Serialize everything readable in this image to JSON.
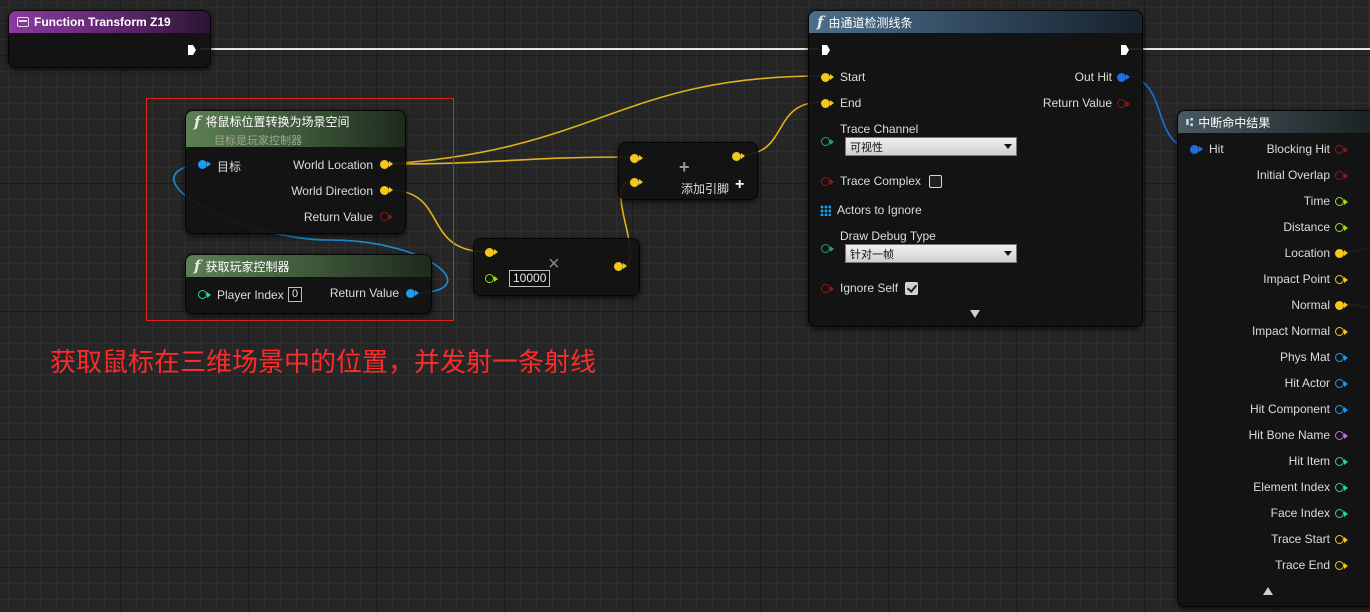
{
  "annotation": "获取鼠标在三维场景中的位置，并发射一条射线",
  "colors": {
    "exec": "#ffffff",
    "vector": "#f2c81b",
    "object": "#1d9bf0",
    "bool": "#8b1818",
    "float": "#96e01a",
    "struct": "#1d6fe0",
    "name": "#b970e0",
    "int": "#20d8a8",
    "selection": "#e02020"
  },
  "nodes": {
    "function_entry": {
      "title": "Function Transform Z19"
    },
    "convert_mouse": {
      "title": "将鼠标位置转换为场景空间",
      "subtitle": "目标是玩家控制器",
      "pin_target": "目标",
      "pin_world_location": "World Location",
      "pin_world_direction": "World Direction",
      "pin_return_value": "Return Value"
    },
    "get_player_controller": {
      "title": "获取玩家控制器",
      "pin_player_index": "Player Index",
      "player_index_value": "0",
      "pin_return_value": "Return Value"
    },
    "multiply": {
      "symbol": "×",
      "value": "10000"
    },
    "add": {
      "symbol": "+",
      "add_pin_label": "添加引脚",
      "add_pin_icon": "+"
    },
    "line_trace": {
      "title": "由通道检测线条",
      "pin_start": "Start",
      "pin_end": "End",
      "pin_out_hit": "Out Hit",
      "pin_return_value": "Return Value",
      "pin_trace_channel": "Trace Channel",
      "trace_channel_value": "可视性",
      "pin_trace_complex": "Trace Complex",
      "trace_complex_checked": false,
      "pin_actors_to_ignore": "Actors to Ignore",
      "pin_draw_debug_type": "Draw Debug Type",
      "draw_debug_type_value": "针对一帧",
      "pin_ignore_self": "Ignore Self",
      "ignore_self_checked": true
    },
    "break_hit": {
      "title": "中断命中结果",
      "pin_hit": "Hit",
      "outputs": [
        {
          "label": "Blocking Hit",
          "type": "bool"
        },
        {
          "label": "Initial Overlap",
          "type": "bool"
        },
        {
          "label": "Time",
          "type": "float"
        },
        {
          "label": "Distance",
          "type": "float"
        },
        {
          "label": "Location",
          "type": "vector"
        },
        {
          "label": "Impact Point",
          "type": "vector"
        },
        {
          "label": "Normal",
          "type": "vector"
        },
        {
          "label": "Impact Normal",
          "type": "vector"
        },
        {
          "label": "Phys Mat",
          "type": "object"
        },
        {
          "label": "Hit Actor",
          "type": "object"
        },
        {
          "label": "Hit Component",
          "type": "object"
        },
        {
          "label": "Hit Bone Name",
          "type": "name"
        },
        {
          "label": "Hit Item",
          "type": "int"
        },
        {
          "label": "Element Index",
          "type": "int"
        },
        {
          "label": "Face Index",
          "type": "int"
        },
        {
          "label": "Trace Start",
          "type": "vector"
        },
        {
          "label": "Trace End",
          "type": "vector"
        }
      ]
    }
  }
}
